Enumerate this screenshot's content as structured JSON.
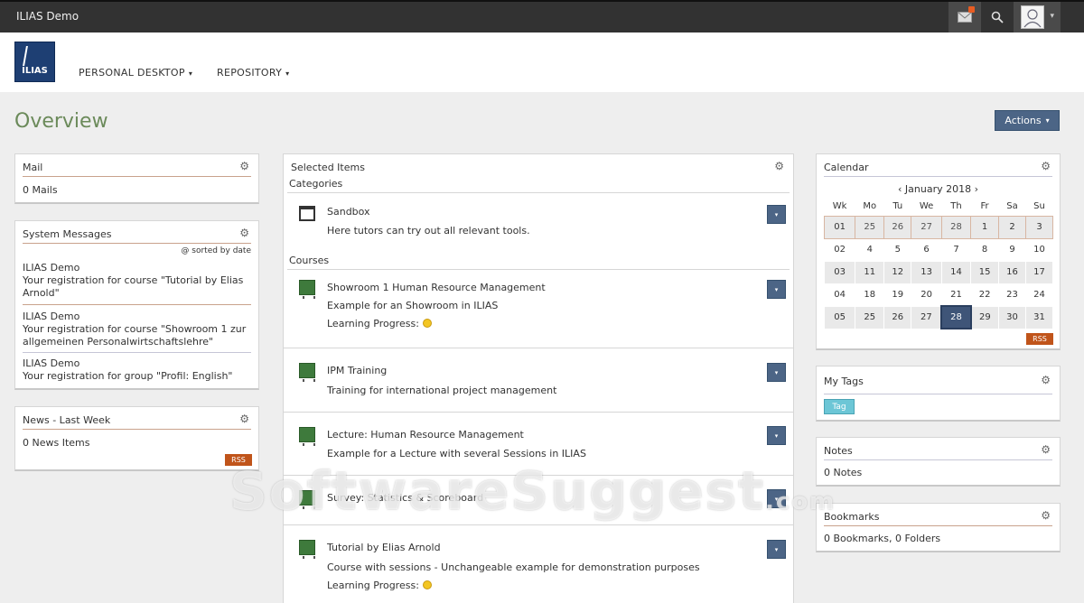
{
  "topbar": {
    "brand": "ILIAS Demo",
    "mail_icon": "envelope-icon",
    "search_icon": "magnifier-icon",
    "user_caret": "▾"
  },
  "header": {
    "logo_text": "ILIAS",
    "nav": [
      {
        "label": "PERSONAL DESKTOP"
      },
      {
        "label": "REPOSITORY"
      }
    ]
  },
  "page": {
    "title": "Overview",
    "actions_label": "Actions"
  },
  "left": {
    "mail": {
      "title": "Mail",
      "body": "0 Mails"
    },
    "system_messages": {
      "title": "System Messages",
      "sort_label": "@ sorted by date",
      "items": [
        {
          "sender": "ILIAS Demo",
          "text": "Your registration for course \"Tutorial by Elias Arnold\""
        },
        {
          "sender": "ILIAS Demo",
          "text": "Your registration for course \"Showroom 1 zur allgemeinen Personalwirtschaftslehre\""
        },
        {
          "sender": "ILIAS Demo",
          "text": "Your registration for group \"Profil: English\""
        }
      ]
    },
    "news": {
      "title": "News - Last Week",
      "body": "0 News Items",
      "rss": "RSS"
    }
  },
  "center": {
    "title": "Selected Items",
    "groups": [
      {
        "label": "Categories"
      },
      {
        "label": "Courses"
      }
    ],
    "items": [
      {
        "title": "Sandbox",
        "desc": "Here tutors can try out all relevant tools.",
        "lp": "",
        "btn": "▾"
      },
      {
        "title": "Showroom 1 Human Resource Management",
        "desc": "Example for an Showroom in ILIAS",
        "lp": "Learning Progress:",
        "btn": "▾"
      },
      {
        "title": "IPM Training",
        "desc": "Training for international project management",
        "lp": "",
        "btn": "▾"
      },
      {
        "title": "Lecture: Human Resource Management",
        "desc": "Example for a Lecture with several Sessions in ILIAS",
        "lp": "",
        "btn": "▾"
      },
      {
        "title": "Survey: Statistics & Scoreboard",
        "desc": "",
        "lp": "",
        "btn": "▾"
      },
      {
        "title": "Tutorial by Elias Arnold",
        "desc": "Course with sessions - Unchangeable example for demonstration purposes",
        "lp": "Learning Progress:",
        "btn": "▾"
      }
    ]
  },
  "right": {
    "calendar": {
      "title": "Calendar",
      "month": "‹ January 2018 ›",
      "weekdays": [
        "Wk",
        "Mo",
        "Tu",
        "We",
        "Th",
        "Fr",
        "Sa",
        "Su"
      ],
      "weeks": [
        [
          "01",
          "25",
          "26",
          "27",
          "28",
          "1",
          "2",
          "3"
        ],
        [
          "02",
          "4",
          "5",
          "6",
          "7",
          "8",
          "9",
          "10"
        ],
        [
          "03",
          "11",
          "12",
          "13",
          "14",
          "15",
          "16",
          "17"
        ],
        [
          "04",
          "18",
          "19",
          "20",
          "21",
          "22",
          "23",
          "24"
        ],
        [
          "05",
          "25",
          "26",
          "27",
          "28",
          "29",
          "30",
          "31"
        ]
      ],
      "today": "28",
      "rss": "RSS"
    },
    "tags": {
      "title": "My Tags",
      "tag": "Tag"
    },
    "notes": {
      "title": "Notes",
      "body": "0 Notes"
    },
    "bookmarks": {
      "title": "Bookmarks",
      "body": "0 Bookmarks, 0 Folders"
    }
  },
  "watermark": {
    "main": "SoftwareSuggest",
    "suffix": ".com"
  }
}
